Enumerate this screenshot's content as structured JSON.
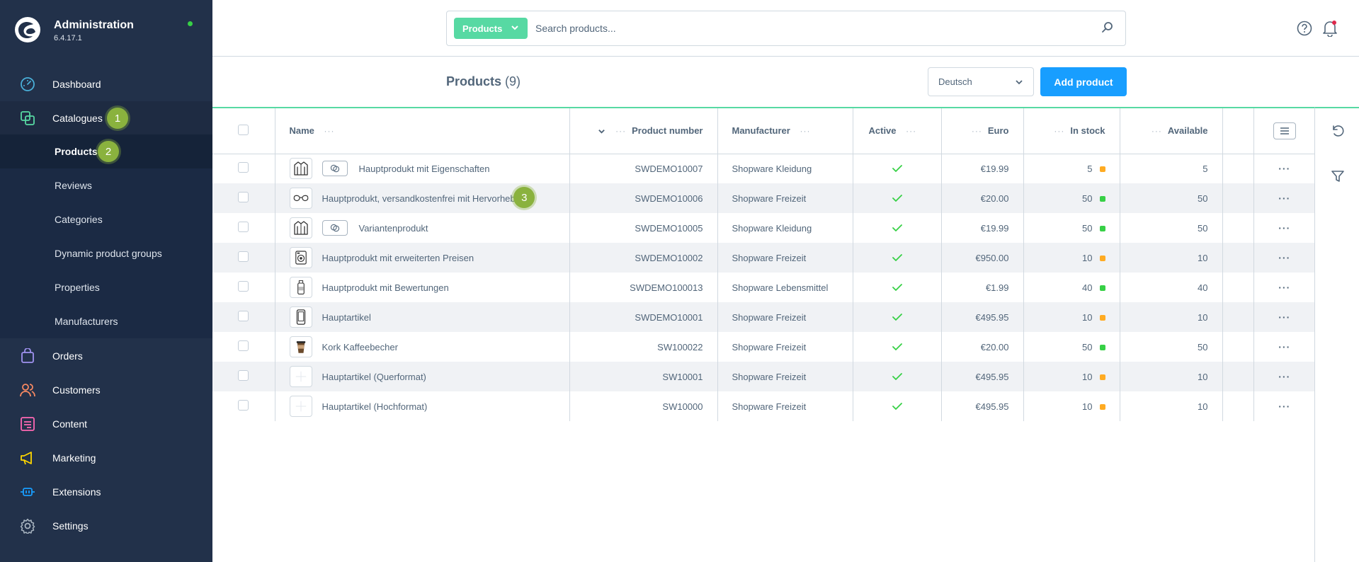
{
  "app": {
    "title": "Administration",
    "version": "6.4.17.1",
    "status_color": "#37d046"
  },
  "sidebar": {
    "items": [
      {
        "label": "Dashboard",
        "icon": "dashboard-icon",
        "color": "#4ab0d9"
      },
      {
        "label": "Catalogues",
        "icon": "catalogue-icon",
        "color": "#57d9a3",
        "badge": "1"
      },
      {
        "label": "Orders",
        "icon": "bag-icon",
        "color": "#a092f0"
      },
      {
        "label": "Customers",
        "icon": "users-icon",
        "color": "#f88962"
      },
      {
        "label": "Content",
        "icon": "content-icon",
        "color": "#ff68b4"
      },
      {
        "label": "Marketing",
        "icon": "megaphone-icon",
        "color": "#ffd700"
      },
      {
        "label": "Extensions",
        "icon": "plug-icon",
        "color": "#189eff"
      },
      {
        "label": "Settings",
        "icon": "gear-icon",
        "color": "#a8b4c0"
      }
    ],
    "sub_items": [
      {
        "label": "Products",
        "badge": "2"
      },
      {
        "label": "Reviews"
      },
      {
        "label": "Categories"
      },
      {
        "label": "Dynamic product groups"
      },
      {
        "label": "Properties"
      },
      {
        "label": "Manufacturers"
      }
    ]
  },
  "search": {
    "type_label": "Products",
    "placeholder": "Search products..."
  },
  "page": {
    "title": "Products",
    "count": "(9)",
    "language": "Deutsch",
    "add_label": "Add product"
  },
  "table": {
    "columns": {
      "name": "Name",
      "product_number": "Product number",
      "manufacturer": "Manufacturer",
      "active": "Active",
      "price": "Euro",
      "stock": "In stock",
      "available": "Available"
    },
    "rows": [
      {
        "name": "Hauptprodukt mit Eigenschaften",
        "thumb": "jacket-icon",
        "variant": true,
        "number": "SWDEMO10007",
        "manufacturer": "Shopware Kleidung",
        "price": "€19.99",
        "stock": "5",
        "stock_status": "low",
        "available": "5"
      },
      {
        "name": "Hauptprodukt, versandkostenfrei mit Hervorhebung",
        "thumb": "glasses-icon",
        "variant": false,
        "number": "SWDEMO10006",
        "manufacturer": "Shopware Freizeit",
        "price": "€20.00",
        "stock": "50",
        "stock_status": "ok",
        "available": "50",
        "badge": "3"
      },
      {
        "name": "Variantenprodukt",
        "thumb": "jacket-icon",
        "variant": true,
        "number": "SWDEMO10005",
        "manufacturer": "Shopware Kleidung",
        "price": "€19.99",
        "stock": "50",
        "stock_status": "ok",
        "available": "50"
      },
      {
        "name": "Hauptprodukt mit erweiterten Preisen",
        "thumb": "camera-icon",
        "variant": false,
        "number": "SWDEMO10002",
        "manufacturer": "Shopware Freizeit",
        "price": "€950.00",
        "stock": "10",
        "stock_status": "low",
        "available": "10"
      },
      {
        "name": "Hauptprodukt mit Bewertungen",
        "thumb": "bottle-icon",
        "variant": false,
        "number": "SWDEMO100013",
        "manufacturer": "Shopware Lebensmittel",
        "price": "€1.99",
        "stock": "40",
        "stock_status": "ok",
        "available": "40"
      },
      {
        "name": "Hauptartikel",
        "thumb": "phone-icon",
        "variant": false,
        "number": "SWDEMO10001",
        "manufacturer": "Shopware Freizeit",
        "price": "€495.95",
        "stock": "10",
        "stock_status": "low",
        "available": "10"
      },
      {
        "name": "Kork Kaffeebecher",
        "thumb": "cup-icon",
        "variant": false,
        "number": "SW100022",
        "manufacturer": "Shopware Freizeit",
        "price": "€20.00",
        "stock": "50",
        "stock_status": "ok",
        "available": "50"
      },
      {
        "name": "Hauptartikel (Querformat)",
        "thumb": "placeholder-icon",
        "variant": false,
        "number": "SW10001",
        "manufacturer": "Shopware Freizeit",
        "price": "€495.95",
        "stock": "10",
        "stock_status": "low",
        "available": "10"
      },
      {
        "name": "Hauptartikel (Hochformat)",
        "thumb": "placeholder-icon",
        "variant": false,
        "number": "SW10000",
        "manufacturer": "Shopware Freizeit",
        "price": "€495.95",
        "stock": "10",
        "stock_status": "low",
        "available": "10"
      }
    ]
  },
  "colors": {
    "accent": "#57d9a3",
    "primary": "#189eff",
    "stock_ok": "#37d046",
    "stock_low": "#ffab22",
    "badge": "#8ab23e"
  }
}
